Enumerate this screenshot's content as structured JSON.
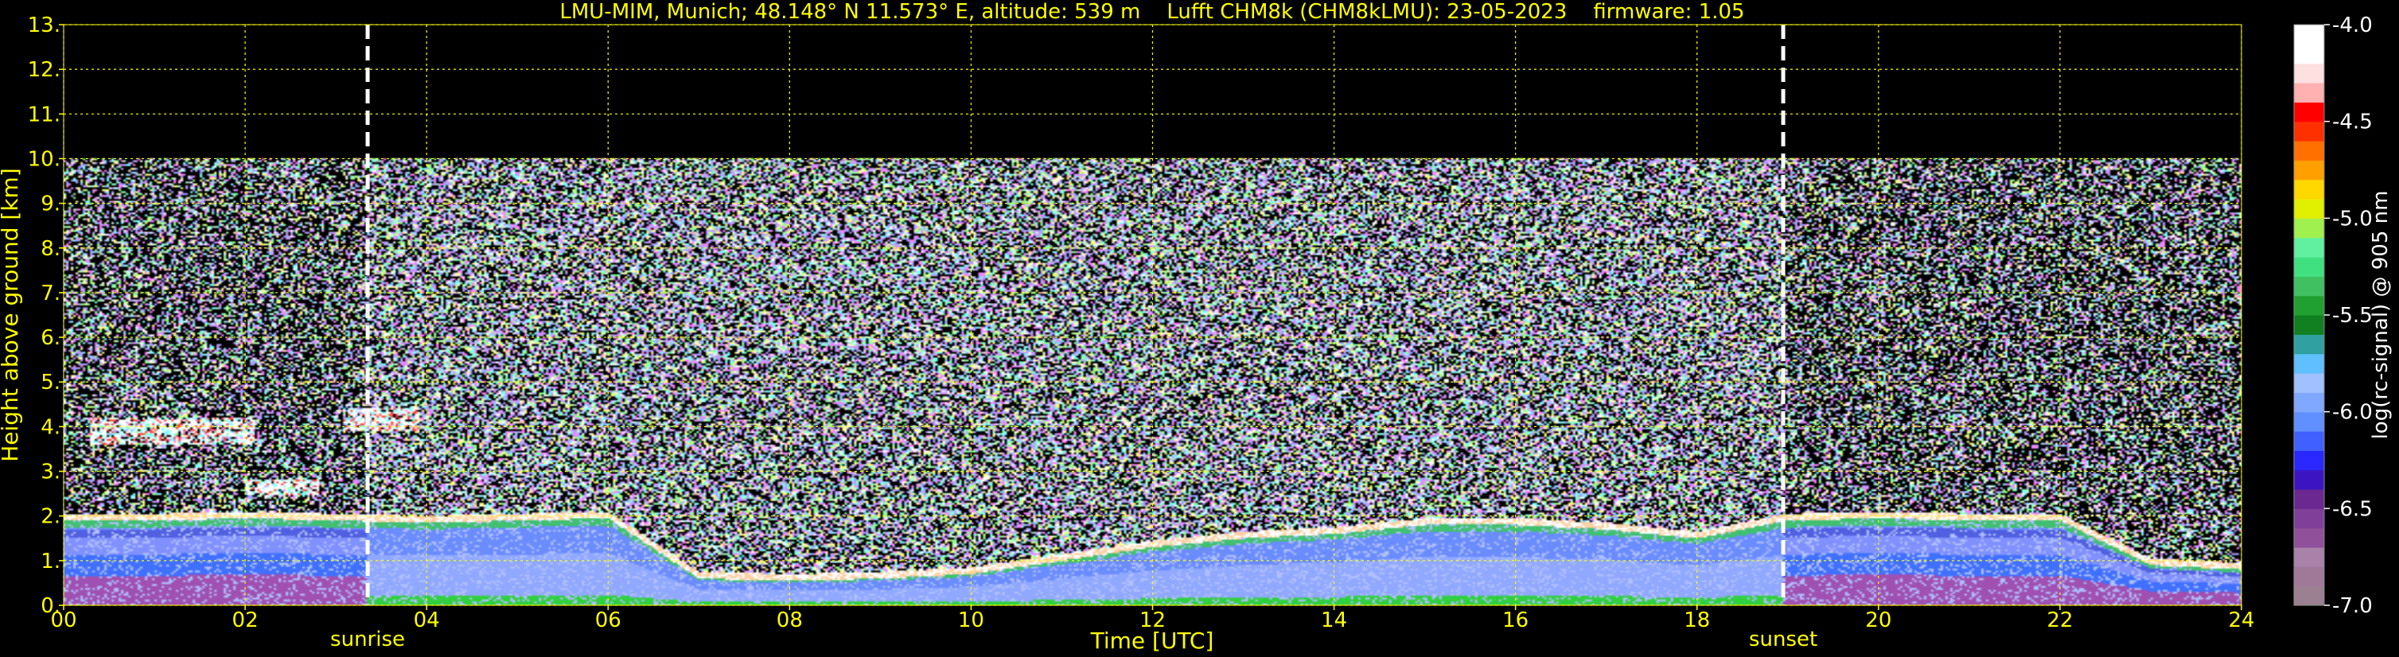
{
  "chart_data": {
    "type": "heatmap",
    "title": "LMU-MIM, Munich; 48.148° N 11.573° E, altitude: 539 m    Lufft CHM8k (CHM8kLMU): 23-05-2023    firmware: 1.05",
    "xlabel": "Time [UTC]",
    "ylabel": "Height above ground [km]",
    "xlim": [
      0,
      24
    ],
    "ylim": [
      0,
      13
    ],
    "x_ticks": [
      "00",
      "02",
      "04",
      "06",
      "08",
      "10",
      "12",
      "14",
      "16",
      "18",
      "20",
      "22",
      "24"
    ],
    "y_ticks": [
      "0.",
      "1.",
      "2.",
      "3.",
      "4.",
      "5.",
      "6.",
      "7.",
      "8.",
      "9.",
      "10.",
      "11.",
      "12.",
      "13."
    ],
    "grid": true,
    "data_ceiling_km": 10,
    "markers": [
      {
        "label": "sunrise",
        "time_utc": 3.35
      },
      {
        "label": "sunset",
        "time_utc": 18.95
      }
    ],
    "colorbar": {
      "label": "log(rc-signal) @ 905 nm",
      "ticks": [
        "-4.0",
        "-4.5",
        "-5.0",
        "-5.5",
        "-6.0",
        "-6.5",
        "-7.0"
      ],
      "range": [
        -7.0,
        -4.0
      ],
      "colors": [
        "#9a8090",
        "#a07898",
        "#a882a8",
        "#90509a",
        "#80409a",
        "#6a2890",
        "#3d15c0",
        "#2a28ff",
        "#4060ff",
        "#6090ff",
        "#80a8ff",
        "#a0c0ff",
        "#60c0ff",
        "#30a0a0",
        "#108020",
        "#20a030",
        "#40c060",
        "#40e080",
        "#60f0a0",
        "#a0f050",
        "#e0f000",
        "#ffd800",
        "#ffa000",
        "#ff7000",
        "#ff3000",
        "#ff0000",
        "#ffb0b0",
        "#ffe0e0",
        "#ffffff",
        "#ffffff"
      ]
    },
    "features": [
      {
        "name": "boundary layer top",
        "times": [
          0,
          1,
          2,
          3,
          4,
          5,
          6,
          7,
          8,
          9,
          10,
          11,
          12,
          13,
          14,
          15,
          16,
          17,
          18,
          19,
          20,
          21,
          22,
          23,
          24
        ],
        "height_km": [
          1.9,
          1.9,
          1.95,
          1.9,
          1.85,
          1.9,
          1.95,
          0.6,
          0.55,
          0.6,
          0.7,
          1.0,
          1.3,
          1.5,
          1.6,
          1.8,
          1.8,
          1.7,
          1.5,
          1.9,
          1.95,
          1.9,
          1.9,
          0.9,
          0.8
        ]
      },
      {
        "name": "cloud layer",
        "time_range": [
          0.3,
          2.1
        ],
        "height_km": [
          3.6,
          4.2
        ]
      },
      {
        "name": "cloud patch",
        "time_range": [
          3.1,
          3.9
        ],
        "height_km": [
          3.9,
          4.4
        ]
      },
      {
        "name": "cloud patch",
        "time_range": [
          2.0,
          2.8
        ],
        "height_km": [
          2.5,
          2.8
        ]
      }
    ]
  }
}
